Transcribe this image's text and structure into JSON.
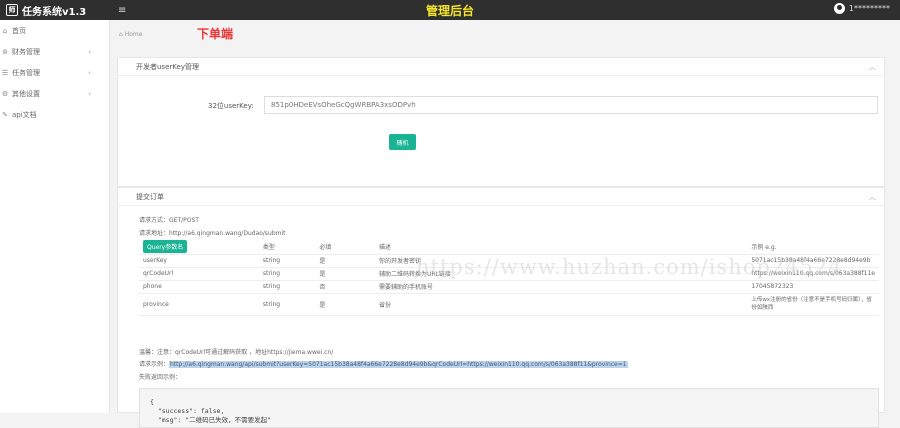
{
  "header": {
    "brand": "任务系统v1.3",
    "logo_glyph": "师",
    "menu_icon": "hamburger-icon",
    "title": "管理后台",
    "username": "1*********"
  },
  "sidebar": {
    "items": [
      {
        "label": "首页",
        "icon": "home-icon",
        "has_submenu": false
      },
      {
        "label": "财务管理",
        "icon": "money-icon",
        "has_submenu": true
      },
      {
        "label": "任务管理",
        "icon": "list-icon",
        "has_submenu": true
      },
      {
        "label": "其他设置",
        "icon": "gear-icon",
        "has_submenu": true
      },
      {
        "label": "api文档",
        "icon": "doc-icon",
        "has_submenu": false
      }
    ]
  },
  "breadcrumb": {
    "home": "Home"
  },
  "order_tag": "下单端",
  "key_panel": {
    "title": "开发者userKey管理",
    "label": "32位userKey:",
    "value": "851p0HDeEVsOheGcQgWRBPA3xsODPvh",
    "button": "随机"
  },
  "submit_panel": {
    "title": "提交订单",
    "method_label": "请求方式：",
    "method": "GET/POST",
    "url_label": "请求地址：",
    "url": "http://a6.qingman.wang/Dudao/submit",
    "columns": [
      "Query参数名",
      "类型",
      "必填",
      "描述",
      "示例 e.g."
    ],
    "rows": [
      {
        "name": "userKey",
        "type": "string",
        "required": "是",
        "desc": "你的开发者密钥",
        "example": "5071ac15b38a48f4a66e7228e8d94e9b"
      },
      {
        "name": "qrCodeUrl",
        "type": "string",
        "required": "是",
        "desc": "辅助二维码转换为URL链接",
        "example": "https://weixin110.qq.com/s/063a388f11e"
      },
      {
        "name": "phone",
        "type": "string",
        "required": "否",
        "desc": "需要辅助的手机账号",
        "example": "17045872323"
      },
      {
        "name": "province",
        "type": "string",
        "required": "是",
        "desc": "省份",
        "example": "上传wx注册的省份（注意不是手机号码归属），省份如陕西"
      }
    ],
    "note_label": "温馨：注意：",
    "note": "qrCodeUrl可通过解码获取 ，地址https://jiema.wwei.cn/",
    "example_label": "请求示例：",
    "example": "http://a6.qingman.wang/api/submit?userKey=5071ac15b38a48f4a66e7228e8d94e9b&qrCodeUrl=https://weixin110.qq.com/s/063a388f11&province=1",
    "fail_label": "失败返回示例：",
    "code": "{\n  \"success\": false,\n  \"msg\": \"二维码已失效，不需要发起\""
  },
  "colors": {
    "accent": "#1ab394",
    "topbar": "#2f2f2f",
    "title": "#f5e52b",
    "tag": "#e33333"
  }
}
